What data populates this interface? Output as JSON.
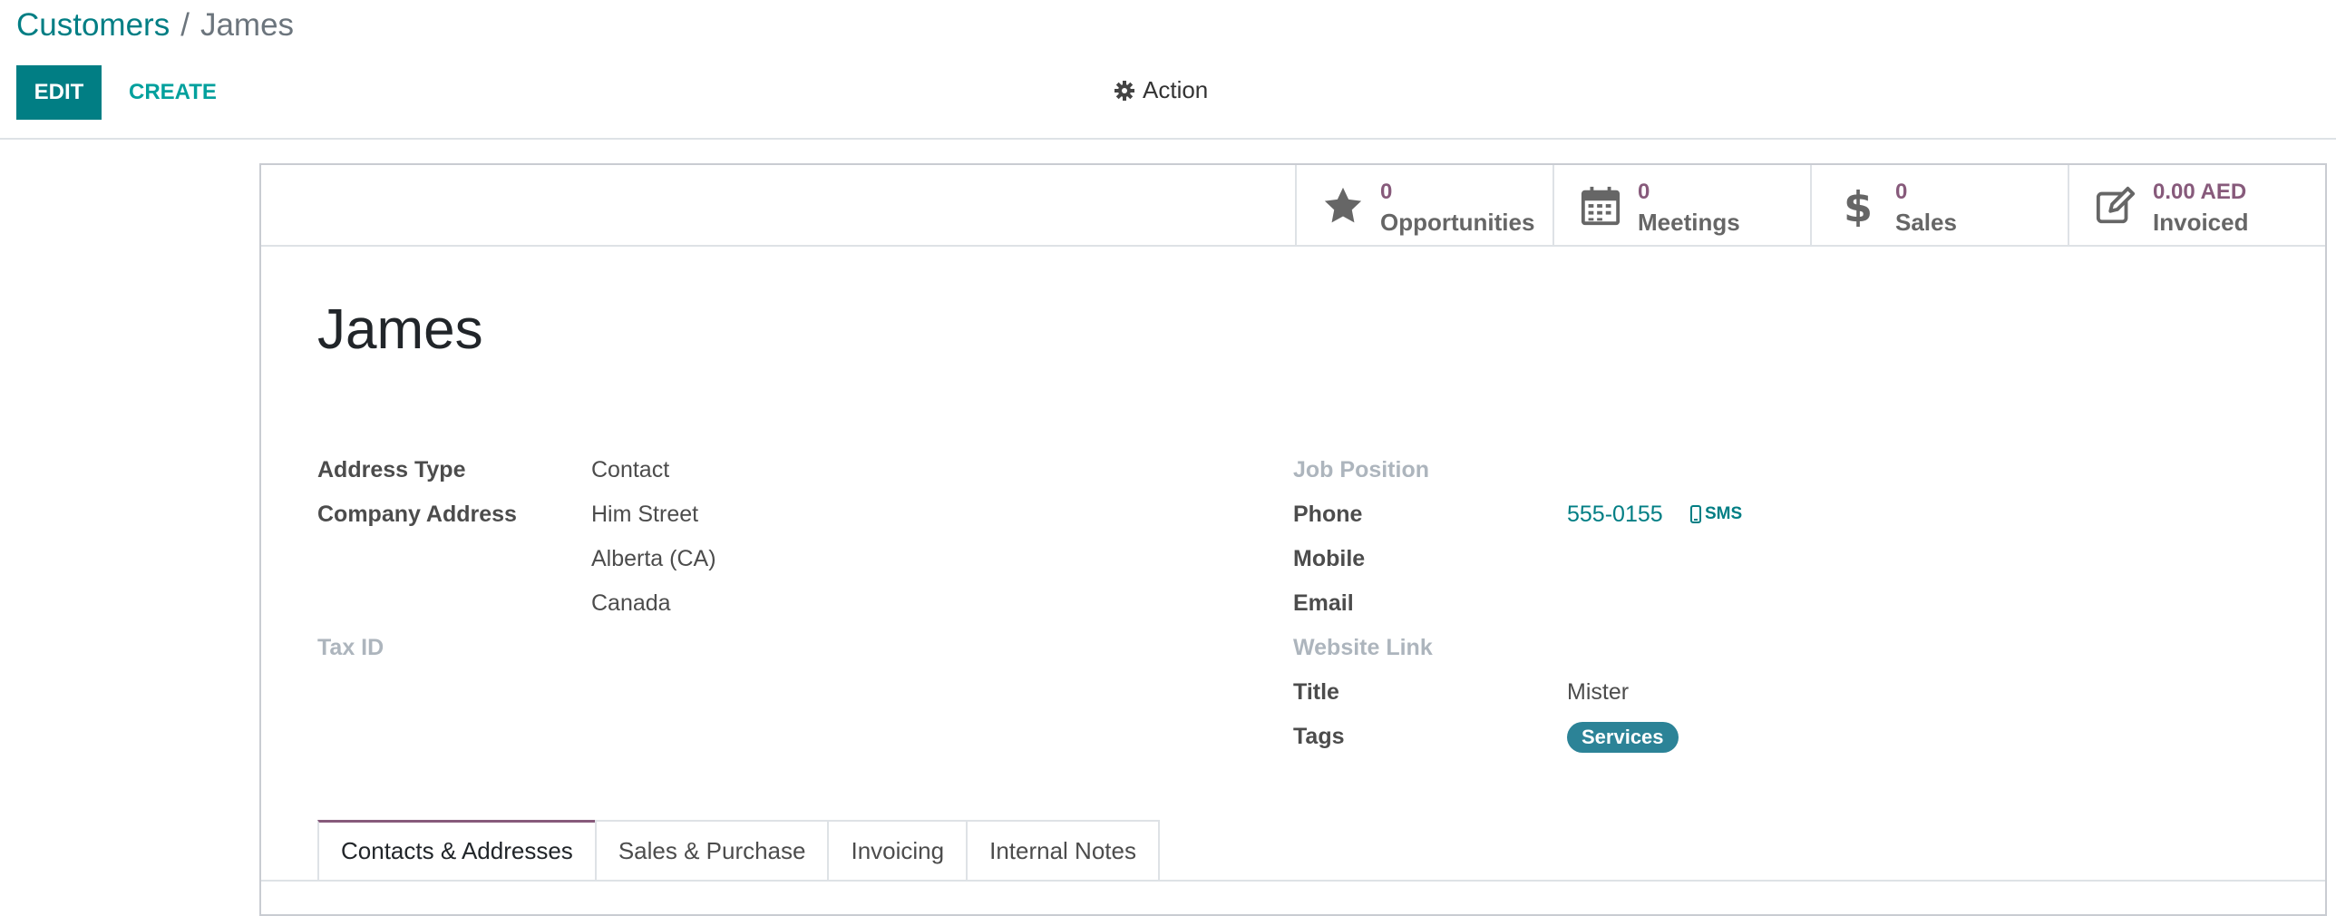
{
  "breadcrumb": {
    "parent": "Customers",
    "separator": "/",
    "current": "James"
  },
  "toolbar": {
    "edit_label": "EDIT",
    "create_label": "CREATE",
    "action_label": "Action",
    "action_icon": "gear-icon"
  },
  "stats": [
    {
      "icon": "star-icon",
      "value": "0",
      "label": "Opportunities"
    },
    {
      "icon": "calendar-icon",
      "value": "0",
      "label": "Meetings"
    },
    {
      "icon": "dollar-icon",
      "value": "0",
      "label": "Sales"
    },
    {
      "icon": "edit-icon",
      "value": "0.00 AED",
      "label": "Invoiced"
    }
  ],
  "record": {
    "name": "James"
  },
  "left_fields": {
    "address_type_label": "Address Type",
    "address_type_value": "Contact",
    "company_address_label": "Company Address",
    "street": "Him Street",
    "state": "Alberta (CA)",
    "country": "Canada",
    "tax_id_label": "Tax ID"
  },
  "right_fields": {
    "job_position_label": "Job Position",
    "phone_label": "Phone",
    "phone_value": "555-0155",
    "sms_label": "SMS",
    "mobile_label": "Mobile",
    "email_label": "Email",
    "website_label": "Website Link",
    "title_label": "Title",
    "title_value": "Mister",
    "tags_label": "Tags",
    "tag_value": "Services"
  },
  "tabs": [
    "Contacts & Addresses",
    "Sales & Purchase",
    "Invoicing",
    "Internal Notes"
  ],
  "colors": {
    "primary": "#017e84",
    "accent": "#875a7b",
    "tag": "#2c8397"
  }
}
